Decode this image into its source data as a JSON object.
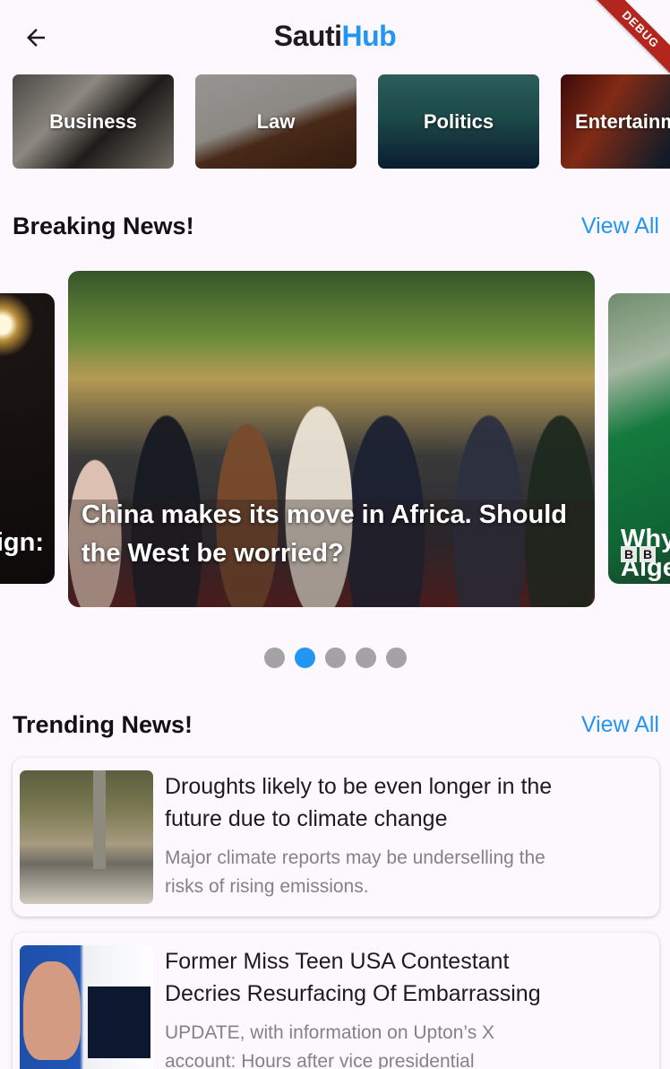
{
  "app": {
    "title_part1": "Sauti",
    "title_part2": "Hub",
    "debug_label": "DEBUG",
    "back_icon": "arrow-left-icon"
  },
  "categories": [
    {
      "label": "Business"
    },
    {
      "label": "Law"
    },
    {
      "label": "Politics"
    },
    {
      "label": "Entertainment"
    }
  ],
  "breaking": {
    "section_title": "Breaking News!",
    "view_all": "View All",
    "prev_partial": "ign:",
    "main_title": "China makes its move in Africa. Should the West be worried?",
    "next_partial": "Why Alge",
    "next_source_letters": [
      "B",
      "B"
    ],
    "active_dot": 1,
    "dot_count": 5
  },
  "trending": {
    "section_title": "Trending News!",
    "view_all": "View All",
    "items": [
      {
        "title": "Droughts likely to be even longer in the future due to climate change",
        "description": "Major climate reports may be underselling the risks of rising emissions."
      },
      {
        "title": "Former Miss Teen USA Contestant Decries Resurfacing Of Embarrassing",
        "description": "UPDATE, with information on Upton’s X account: Hours after vice presidential"
      }
    ]
  },
  "colors": {
    "accent": "#2196f3",
    "background": "#fdf7fe",
    "debug_ribbon": "#b3261e",
    "dot_inactive": "#a3a3a3"
  }
}
